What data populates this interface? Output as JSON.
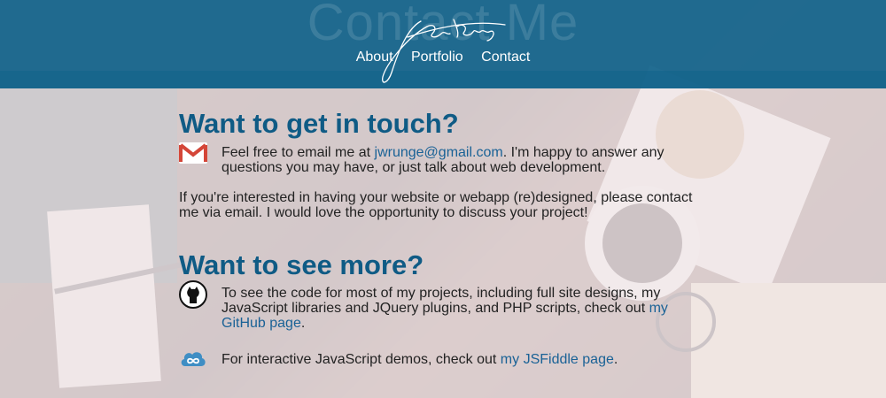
{
  "header": {
    "ghost_title": "Contact Me",
    "nav": [
      "About",
      "Portfolio",
      "Contact"
    ]
  },
  "contact": {
    "heading": "Want to get in touch?",
    "email_prefix": "Feel free to email me at ",
    "email_link": "jwrunge@gmail.com",
    "email_suffix": ". I'm happy to answer any questions you may have, or just talk about web development.",
    "paragraph2": "If you're interested in having your website or webapp (re)designed, please contact me via email. I would love the opportunity to discuss your project!"
  },
  "more": {
    "heading": "Want to see more?",
    "github_prefix": "To see the code for most of my projects, including full site designs, my JavaScript libraries and JQuery plugins, and PHP scripts, check out ",
    "github_link": "my GitHub page",
    "github_suffix": ".",
    "jsfiddle_prefix": "For interactive JavaScript demos, check out ",
    "jsfiddle_link": "my JSFiddle page",
    "jsfiddle_suffix": "."
  },
  "icons": {
    "gmail": "gmail-icon",
    "github": "github-icon",
    "jsfiddle": "jsfiddle-cloud-icon"
  },
  "colors": {
    "header": "#10628a",
    "heading": "#0f5b85",
    "link": "#1a6296"
  }
}
